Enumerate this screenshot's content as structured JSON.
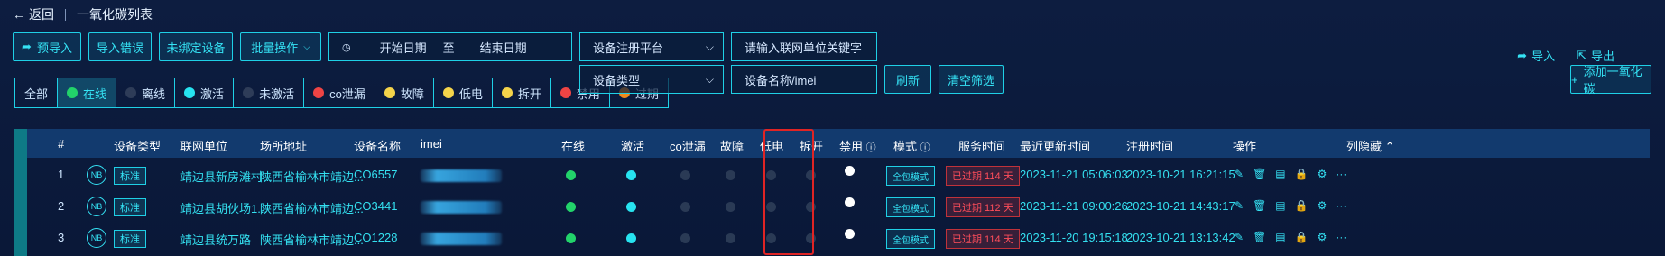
{
  "header": {
    "back_label": "返回",
    "title": "一氧化碳列表"
  },
  "toolbar": {
    "pre_import": "预导入",
    "import_errors": "导入错误",
    "unbound_devices": "未绑定设备",
    "batch_ops": "批量操作",
    "date_start_placeholder": "开始日期",
    "date_to": "至",
    "date_end_placeholder": "结束日期",
    "platform_placeholder": "设备注册平台",
    "unit_keyword_placeholder": "请输入联网单位关键字",
    "import": "导入",
    "export": "导出",
    "device_type_placeholder": "设备类型",
    "device_name_placeholder": "设备名称/imei",
    "refresh": "刷新",
    "clear_filter": "清空筛选",
    "add_co": "添加一氧化碳"
  },
  "filters": [
    {
      "label": "全部",
      "color": ""
    },
    {
      "label": "在线",
      "color": "#22d36a"
    },
    {
      "label": "离线",
      "color": "#2e3c58"
    },
    {
      "label": "激活",
      "color": "#27e3f0"
    },
    {
      "label": "未激活",
      "color": "#2e3c58"
    },
    {
      "label": "co泄漏",
      "color": "#ef4444"
    },
    {
      "label": "故障",
      "color": "#f5d44a"
    },
    {
      "label": "低电",
      "color": "#f5d44a"
    },
    {
      "label": "拆开",
      "color": "#f5d44a"
    },
    {
      "label": "禁用",
      "color": "#ef4444"
    },
    {
      "label": "过期",
      "color": "#f08a1c"
    }
  ],
  "table": {
    "columns": {
      "index": "#",
      "device_type": "设备类型",
      "unit": "联网单位",
      "address": "场所地址",
      "device_name": "设备名称",
      "imei": "imei",
      "online": "在线",
      "active": "激活",
      "co_leak": "co泄漏",
      "fault": "故障",
      "low_battery": "低电",
      "opened": "拆开",
      "disabled": "禁用",
      "mode": "模式",
      "service_time": "服务时间",
      "last_update": "最近更新时间",
      "register_time": "注册时间",
      "operations": "操作",
      "hide_columns": "列隐藏"
    },
    "rows": [
      {
        "index": "1",
        "nb": "NB",
        "type": "标准",
        "unit": "靖边县新房滩村...",
        "address": "陕西省榆林市靖边...",
        "name": "CO6557",
        "mode": "全包模式",
        "service": "已过期 114 天",
        "last_update": "2023-11-21 05:06:03",
        "register": "2023-10-21 16:21:15"
      },
      {
        "index": "2",
        "nb": "NB",
        "type": "标准",
        "unit": "靖边县胡伙场1...",
        "address": "陕西省榆林市靖边...",
        "name": "CO3441",
        "mode": "全包模式",
        "service": "已过期 112 天",
        "last_update": "2023-11-21 09:00:26",
        "register": "2023-10-21 14:43:17"
      },
      {
        "index": "3",
        "nb": "NB",
        "type": "标准",
        "unit": "靖边县统万路",
        "address": "陕西省榆林市靖边...",
        "name": "CO1228",
        "mode": "全包模式",
        "service": "已过期 114 天",
        "last_update": "2023-11-20 19:15:18",
        "register": "2023-10-21 13:13:42"
      }
    ]
  },
  "colors": {
    "online": "#22d36a",
    "active": "#27e3f0",
    "inactive_dot": "#2a3a55",
    "disabled_dot": "#ffffff",
    "accent": "#1fd0e6",
    "highlight": "#e02424"
  }
}
